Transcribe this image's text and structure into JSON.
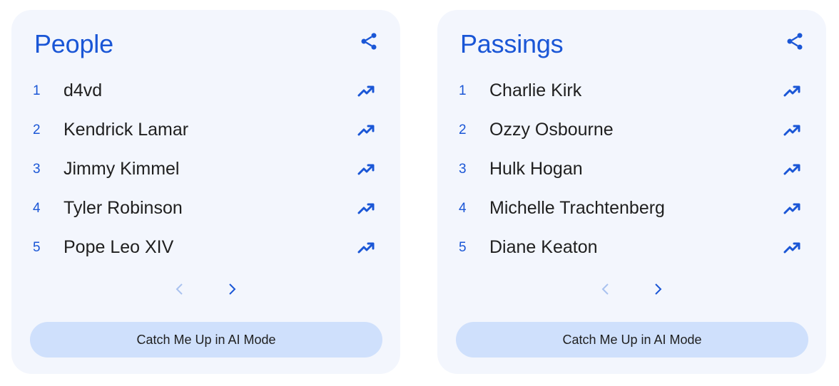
{
  "colors": {
    "accent": "#1a56d6",
    "card_background": "#f3f6fd",
    "button_background": "#cfe0fc",
    "text": "#1f1f1f",
    "disabled_arrow": "#a9c2ef"
  },
  "cards": [
    {
      "title": "People",
      "items": [
        {
          "rank": "1",
          "name": "d4vd"
        },
        {
          "rank": "2",
          "name": "Kendrick Lamar"
        },
        {
          "rank": "3",
          "name": "Jimmy Kimmel"
        },
        {
          "rank": "4",
          "name": "Tyler Robinson"
        },
        {
          "rank": "5",
          "name": "Pope Leo XIV"
        }
      ],
      "cta_label": "Catch Me Up in AI Mode"
    },
    {
      "title": "Passings",
      "items": [
        {
          "rank": "1",
          "name": "Charlie Kirk"
        },
        {
          "rank": "2",
          "name": "Ozzy Osbourne"
        },
        {
          "rank": "3",
          "name": "Hulk Hogan"
        },
        {
          "rank": "4",
          "name": "Michelle Trachtenberg"
        },
        {
          "rank": "5",
          "name": "Diane Keaton"
        }
      ],
      "cta_label": "Catch Me Up in AI Mode"
    }
  ],
  "icons": {
    "share": "share-icon",
    "trend": "trending-up-icon",
    "prev": "chevron-left-icon",
    "next": "chevron-right-icon"
  }
}
